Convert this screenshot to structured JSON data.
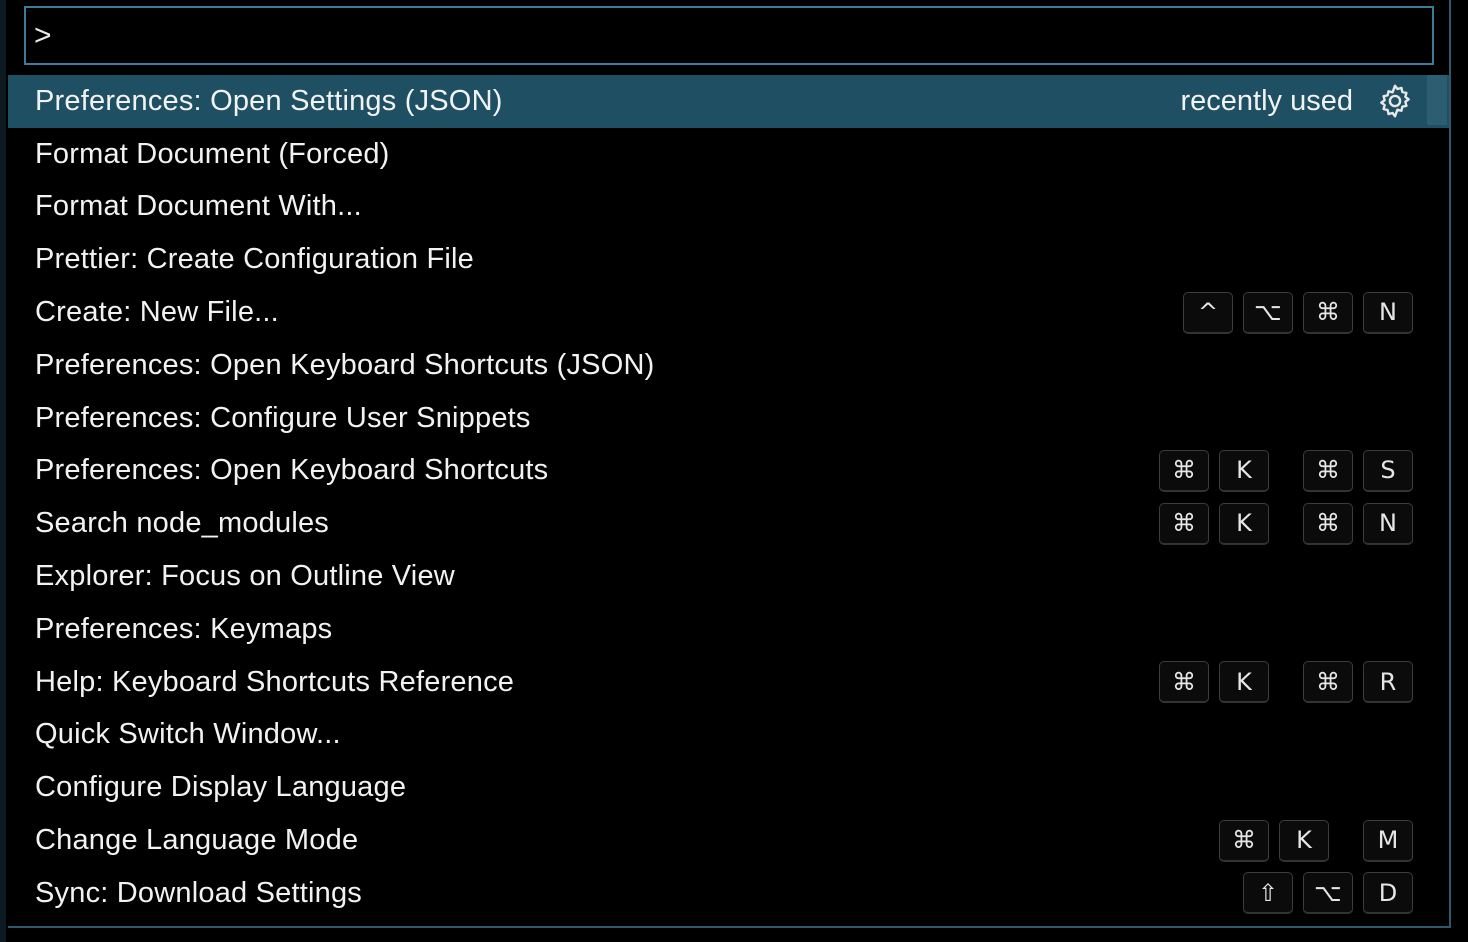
{
  "search": {
    "value": ">"
  },
  "items": [
    {
      "label": "Preferences: Open Settings (JSON)",
      "note": "recently used",
      "icon": "gear-icon",
      "selected": true,
      "chords": []
    },
    {
      "label": "Format Document (Forced)",
      "chords": []
    },
    {
      "label": "Format Document With...",
      "chords": []
    },
    {
      "label": "Prettier: Create Configuration File",
      "chords": []
    },
    {
      "label": "Create: New File...",
      "chords": [
        [
          "^",
          "⌥",
          "⌘",
          "N"
        ]
      ]
    },
    {
      "label": "Preferences: Open Keyboard Shortcuts (JSON)",
      "chords": []
    },
    {
      "label": "Preferences: Configure User Snippets",
      "chords": []
    },
    {
      "label": "Preferences: Open Keyboard Shortcuts",
      "chords": [
        [
          "⌘",
          "K"
        ],
        [
          "⌘",
          "S"
        ]
      ]
    },
    {
      "label": "Search node_modules",
      "chords": [
        [
          "⌘",
          "K"
        ],
        [
          "⌘",
          "N"
        ]
      ]
    },
    {
      "label": "Explorer: Focus on Outline View",
      "chords": []
    },
    {
      "label": "Preferences: Keymaps",
      "chords": []
    },
    {
      "label": "Help: Keyboard Shortcuts Reference",
      "chords": [
        [
          "⌘",
          "K"
        ],
        [
          "⌘",
          "R"
        ]
      ]
    },
    {
      "label": "Quick Switch Window...",
      "chords": []
    },
    {
      "label": "Configure Display Language",
      "chords": []
    },
    {
      "label": "Change Language Mode",
      "chords": [
        [
          "⌘",
          "K"
        ],
        [
          "M"
        ]
      ]
    },
    {
      "label": "Sync: Download Settings",
      "chords": [
        [
          "⇧",
          "⌥",
          "D"
        ]
      ]
    }
  ],
  "colors": {
    "selected_bg": "#1e4f63",
    "input_border": "#3a7d9b",
    "text": "#f2f2f2"
  }
}
